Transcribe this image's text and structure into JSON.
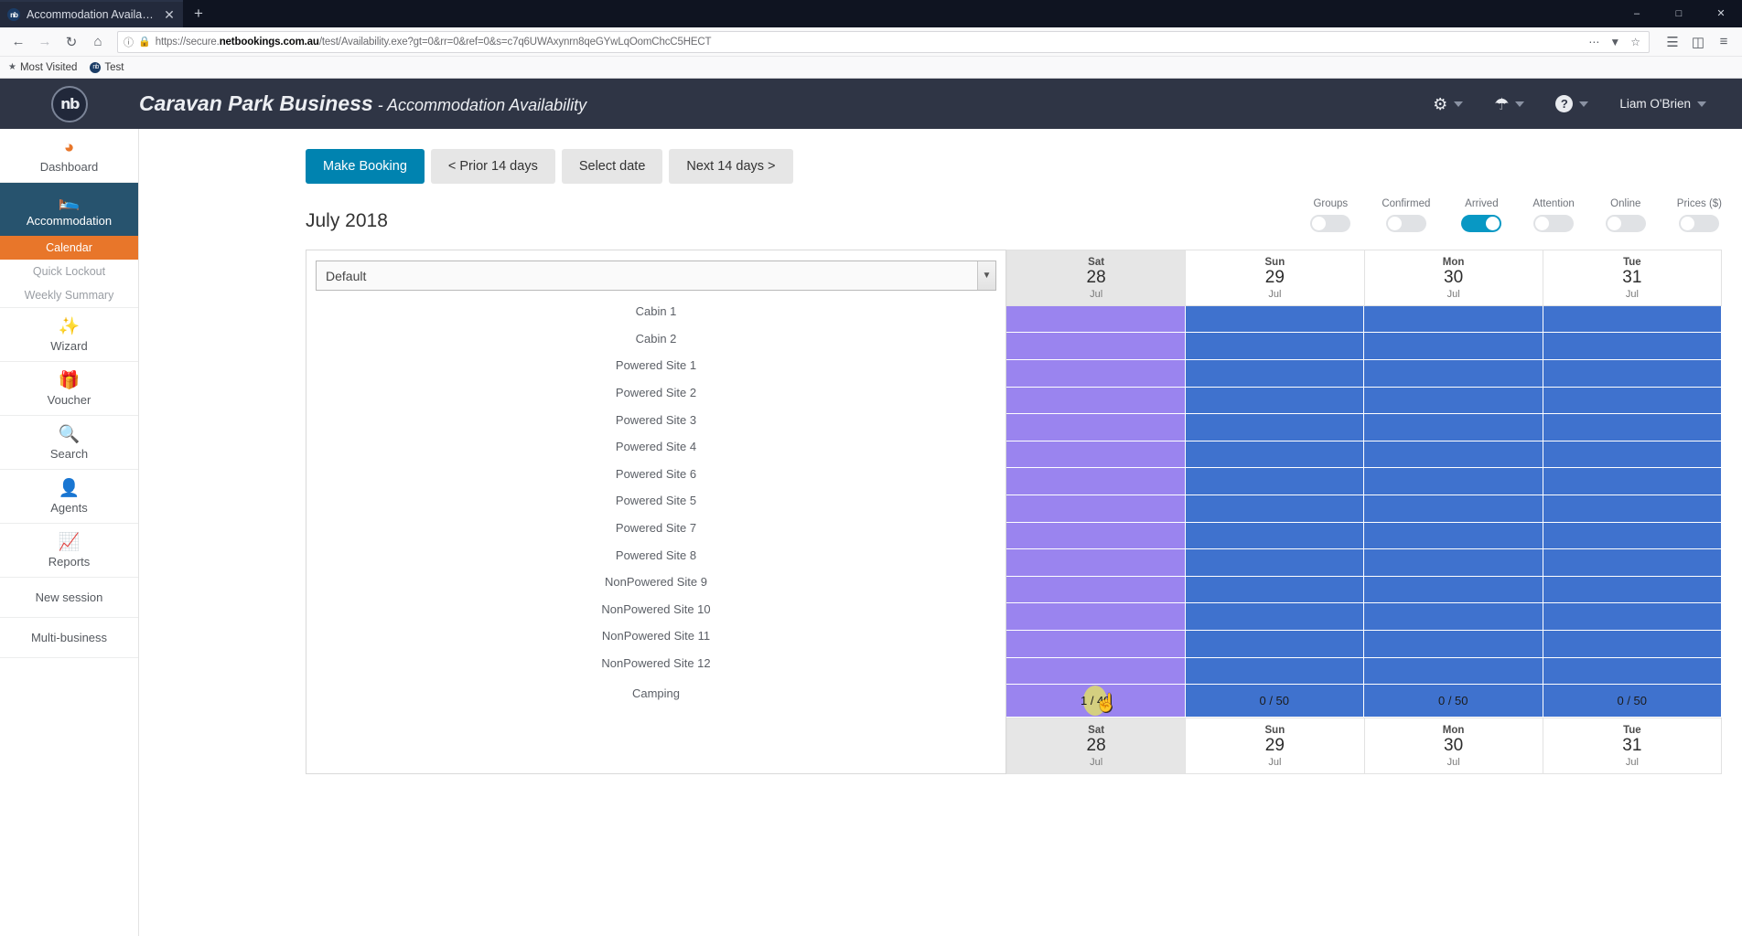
{
  "browser": {
    "tab": {
      "title": "Accommodation Availability",
      "favicon": "nb",
      "close_icon": "close-icon"
    },
    "newtab_icon": "plus-icon",
    "window_controls": {
      "minimize": "–",
      "maximize": "□",
      "close": "✕"
    },
    "nav": {
      "back_icon": "back-arrow-icon",
      "forward_icon": "forward-arrow-icon",
      "reload_icon": "reload-icon",
      "home_icon": "home-icon",
      "info_icon": "info-icon",
      "lock_icon": "lock-icon",
      "url_prefix": "https://secure.",
      "url_domain": "netbookings.com.au",
      "url_suffix": "/test/Availability.exe?gt=0&rr=0&ref=0&s=c7q6UWAxynrn8qeGYwLqOomChcC5HECT",
      "ellipsis_icon": "more-icon",
      "pocket_icon": "pocket-icon",
      "star_icon": "bookmark-star-icon",
      "library_icon": "library-icon",
      "sidebar_icon": "sidebar-icon",
      "menu_icon": "hamburger-menu-icon"
    },
    "bookmarks": [
      {
        "label": "Most Visited",
        "icon": "most-visited-icon"
      },
      {
        "label": "Test",
        "icon": "nb-favicon"
      }
    ]
  },
  "header": {
    "logo_text": "nb",
    "business_name": "Caravan Park Business",
    "dash": " - ",
    "page_name": "Accommodation Availability",
    "gear_icon": "gear-icon",
    "user_icon": "user-icon",
    "help_icon": "question-mark-icon",
    "username": "Liam O'Brien"
  },
  "sidebar": {
    "items": [
      {
        "name": "dashboard",
        "label": "Dashboard",
        "icon": "dashboard-icon",
        "active": false
      },
      {
        "name": "accommodation",
        "label": "Accommodation",
        "icon": "bed-icon",
        "active": true
      }
    ],
    "sub_items": [
      {
        "name": "calendar",
        "label": "Calendar",
        "selected": true
      },
      {
        "name": "quick-lockout",
        "label": "Quick Lockout",
        "selected": false
      },
      {
        "name": "weekly-summary",
        "label": "Weekly Summary",
        "selected": false
      }
    ],
    "items2": [
      {
        "name": "wizard",
        "label": "Wizard",
        "icon": "magic-wand-icon"
      },
      {
        "name": "voucher",
        "label": "Voucher",
        "icon": "gift-icon"
      },
      {
        "name": "search",
        "label": "Search",
        "icon": "search-icon"
      },
      {
        "name": "agents",
        "label": "Agents",
        "icon": "agent-person-icon"
      },
      {
        "name": "reports",
        "label": "Reports",
        "icon": "chart-up-icon"
      }
    ],
    "plain_items": [
      {
        "name": "new-session",
        "label": "New session"
      },
      {
        "name": "multi-business",
        "label": "Multi-business"
      }
    ]
  },
  "toolbar": {
    "make_booking": "Make Booking",
    "prior_days": "< Prior 14 days",
    "select_date": "Select date",
    "next_days": "Next 14 days >"
  },
  "main": {
    "month_title": "July 2018",
    "room_filter_value": "Default",
    "dropdown_icon": "chevron-down-icon",
    "toggles": [
      {
        "name": "groups",
        "label": "Groups",
        "on": false
      },
      {
        "name": "confirmed",
        "label": "Confirmed",
        "on": false
      },
      {
        "name": "arrived",
        "label": "Arrived",
        "on": true
      },
      {
        "name": "attention",
        "label": "Attention",
        "on": false
      },
      {
        "name": "online",
        "label": "Online",
        "on": false
      },
      {
        "name": "prices",
        "label": "Prices ($)",
        "on": false
      }
    ],
    "accent_color": "#0083b0",
    "toggle_on_color": "#0898c4",
    "purple_color": "#9a84ef",
    "blue_color": "#3f72ce",
    "hover_color": "#d4cf80",
    "rooms": [
      "Cabin 1",
      "Cabin 2",
      "Powered Site 1",
      "Powered Site 2",
      "Powered Site 3",
      "Powered Site 4",
      "Powered Site 6",
      "Powered Site 5",
      "Powered Site 7",
      "Powered Site 8",
      "NonPowered Site 9",
      "NonPowered Site 10",
      "NonPowered Site 11",
      "NonPowered Site 12"
    ],
    "camping_label": "Camping",
    "days": [
      {
        "dow": "Sat",
        "num": "28",
        "mon": "Jul",
        "weekend": true,
        "color": "purple",
        "camping_value": "1 / 49",
        "hovered": true
      },
      {
        "dow": "Sun",
        "num": "29",
        "mon": "Jul",
        "weekend": false,
        "color": "blue",
        "camping_value": "0 / 50",
        "hovered": false
      },
      {
        "dow": "Mon",
        "num": "30",
        "mon": "Jul",
        "weekend": false,
        "color": "blue",
        "camping_value": "0 / 50",
        "hovered": false
      },
      {
        "dow": "Tue",
        "num": "31",
        "mon": "Jul",
        "weekend": false,
        "color": "blue",
        "camping_value": "0 / 50",
        "hovered": false
      }
    ],
    "cursor_icon": "hand-pointer-cursor"
  }
}
